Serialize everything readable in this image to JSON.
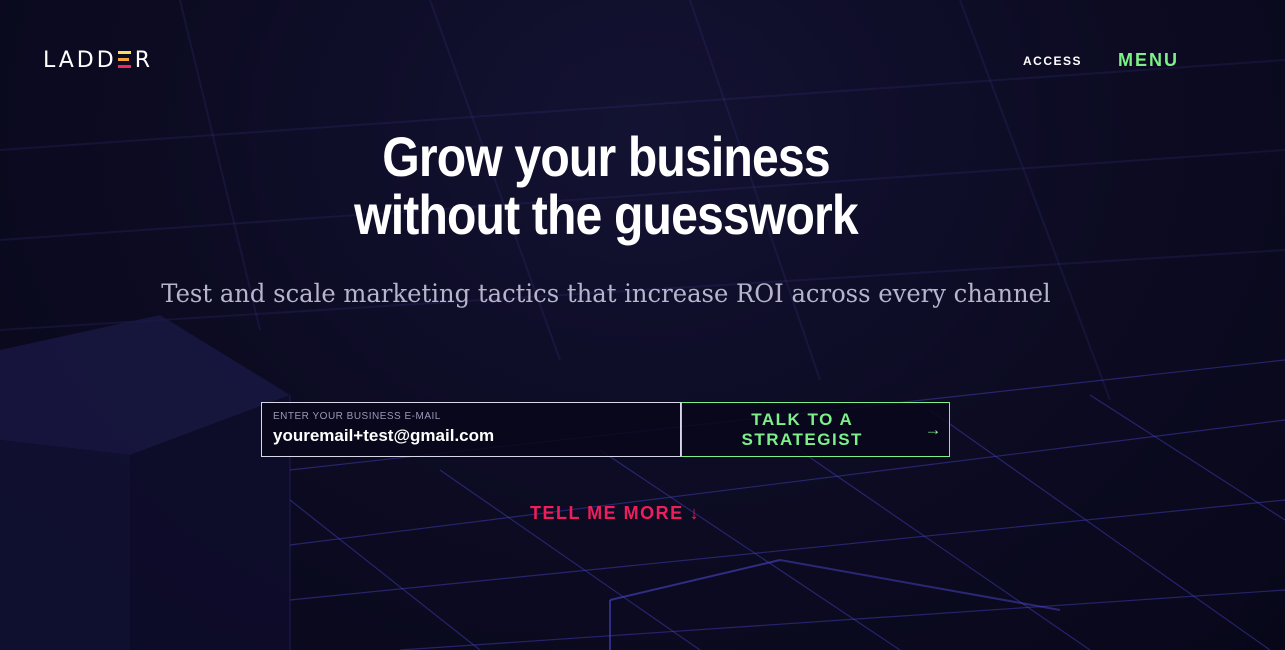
{
  "header": {
    "logo_prefix": "LADD",
    "logo_suffix": "R",
    "logo_bar_colors": [
      "#f2e35a",
      "#f3a33a",
      "#ee2a5c"
    ],
    "nav_access": "ACCESS",
    "nav_menu": "MENU"
  },
  "hero": {
    "headline_line1": "Grow your business",
    "headline_line2": "without the guesswork",
    "subheadline": "Test and scale marketing tactics that increase ROI across every channel"
  },
  "signup": {
    "email_label": "ENTER YOUR BUSINESS E-MAIL",
    "email_value": "youremail+test@gmail.com",
    "cta_label": "TALK TO A STRATEGIST",
    "cta_arrow": "→"
  },
  "tell_more": {
    "label": "TELL ME MORE",
    "arrow": "↓"
  },
  "colors": {
    "background": "#0b0a1f",
    "accent_green": "#7df08a",
    "accent_pink": "#ee1e5c",
    "grid_line": "#3a35a0"
  },
  "icons": {
    "cta_arrow": "arrow-right-icon",
    "tell_more_arrow": "arrow-down-icon"
  }
}
